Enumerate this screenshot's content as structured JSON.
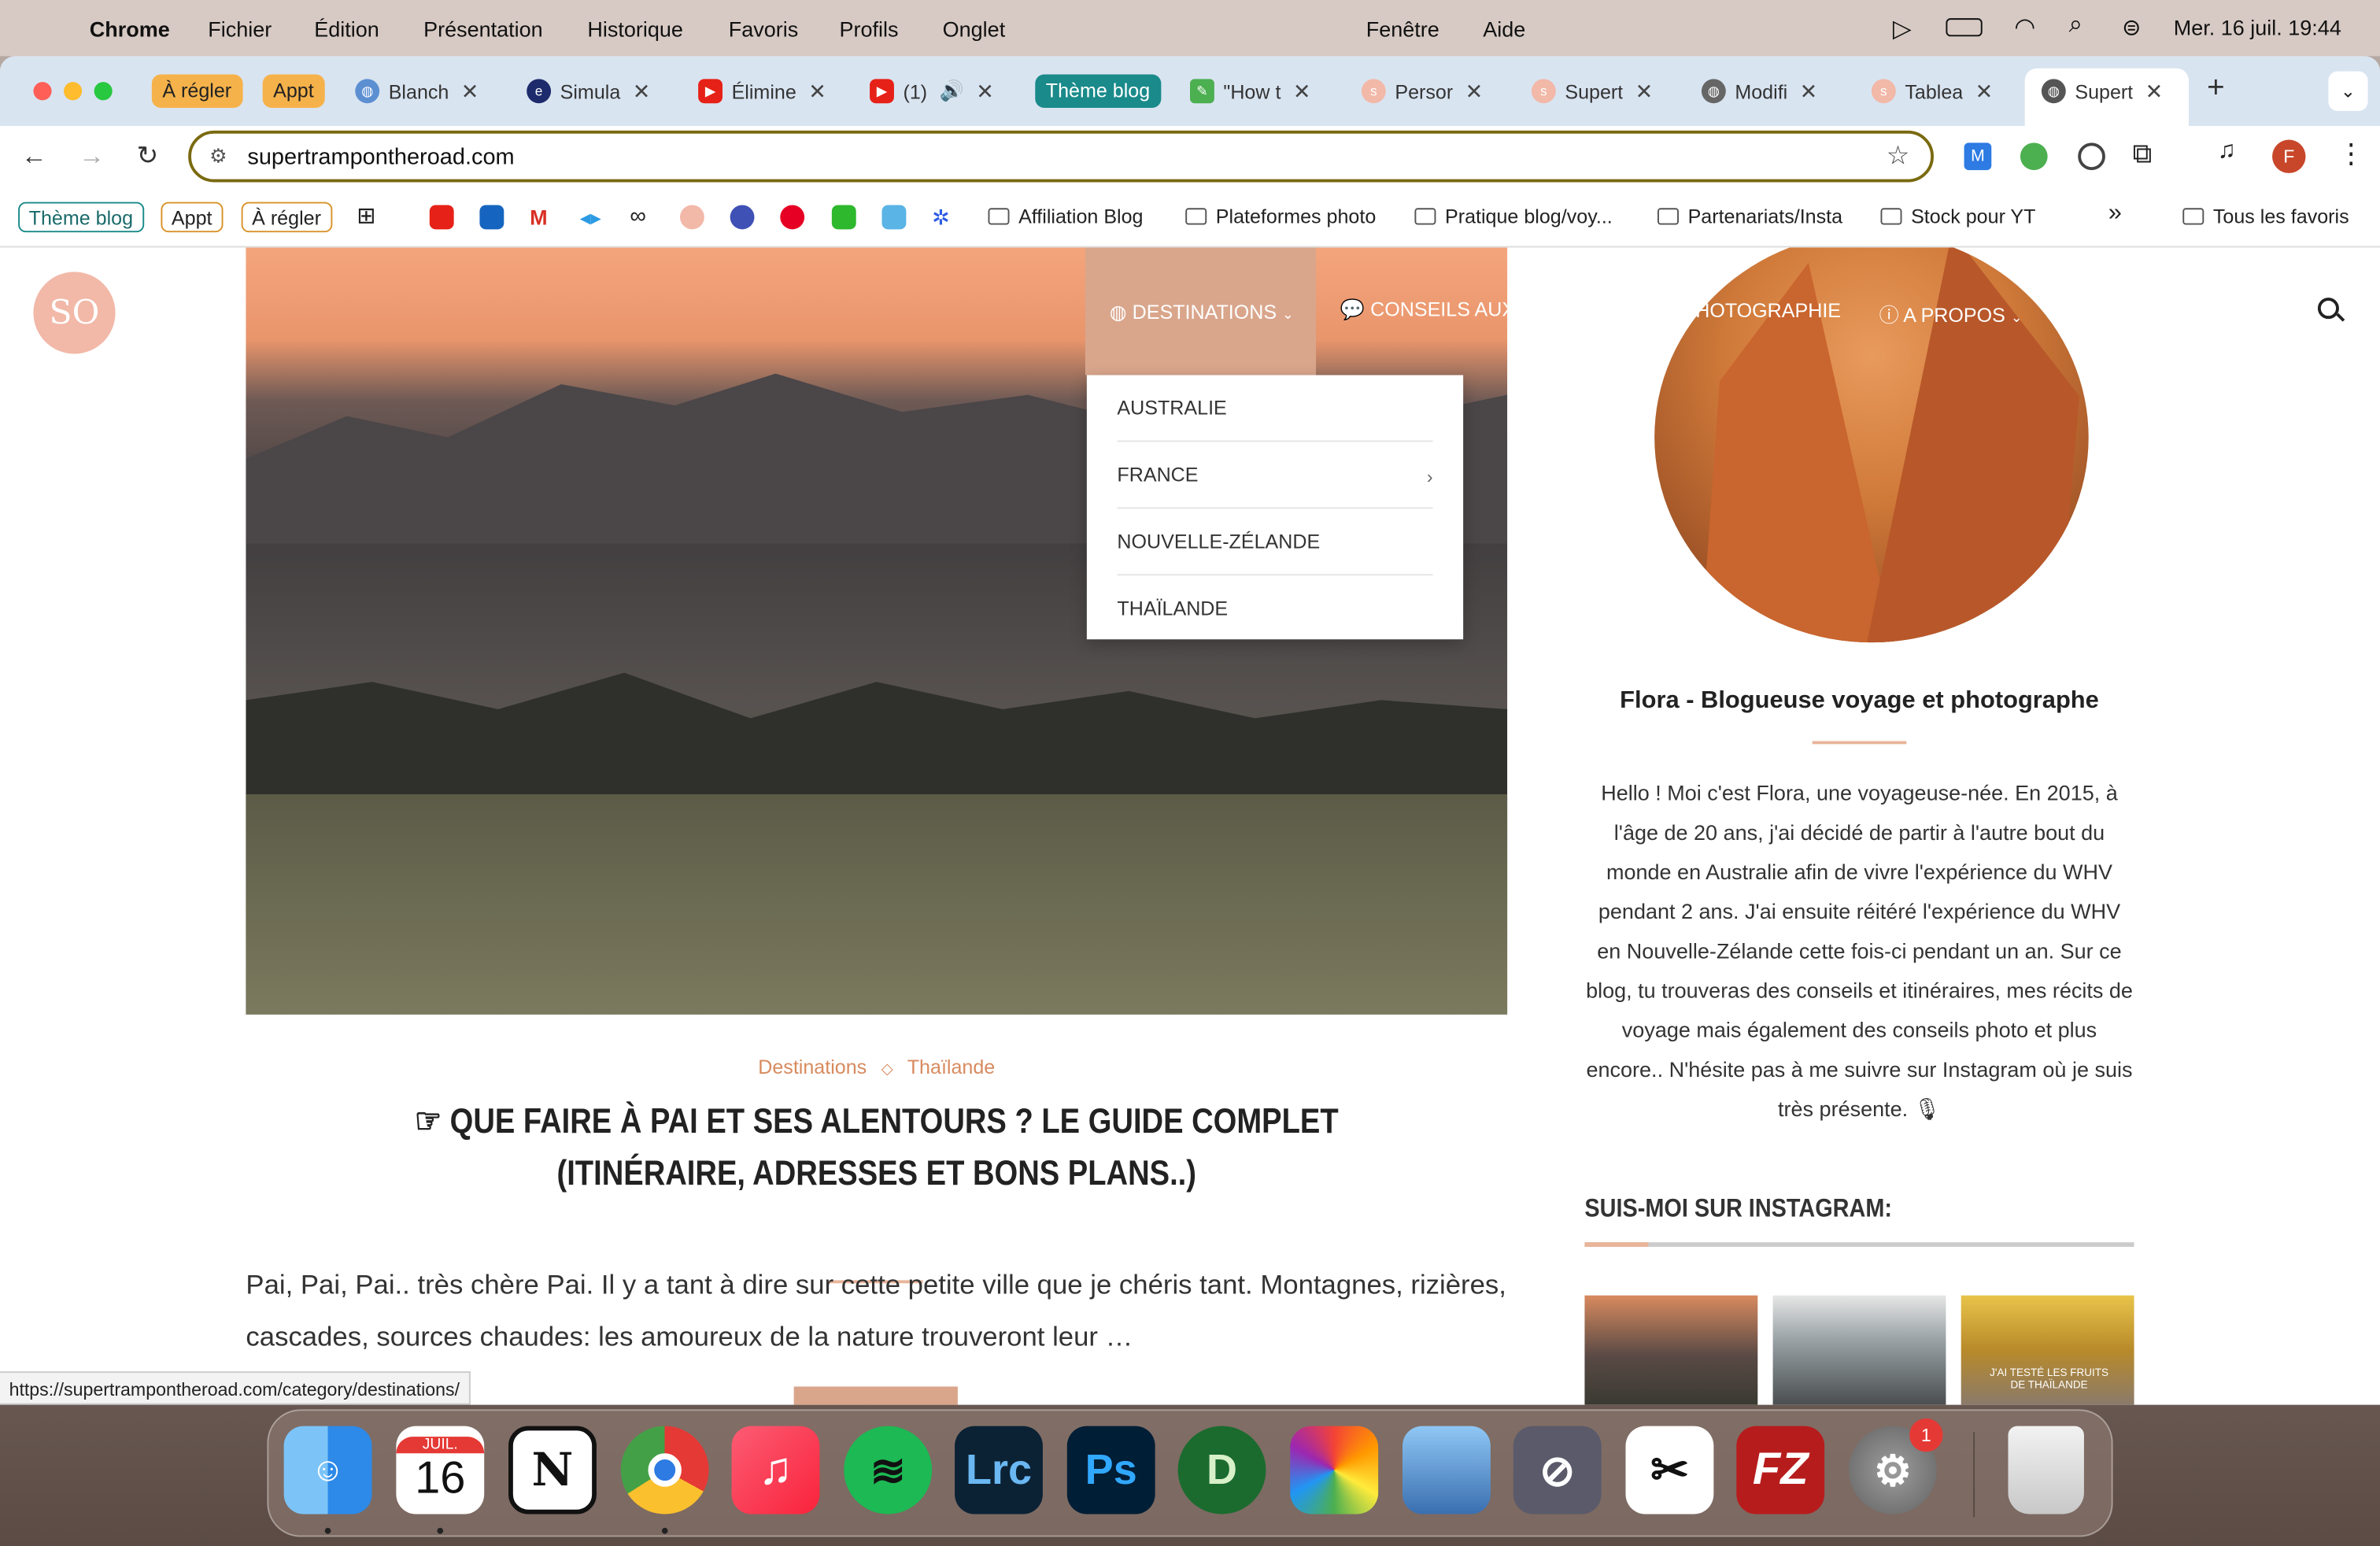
{
  "menubar": {
    "app_name": "Chrome",
    "menus": [
      "Fichier",
      "Édition",
      "Présentation",
      "Historique",
      "Favoris",
      "Profils",
      "Onglet",
      "Fenêtre",
      "Aide"
    ],
    "clock": "Mer. 16 juil.  19:44"
  },
  "tabs": {
    "groups": [
      {
        "label": "À régler",
        "color": "#f6b24a"
      },
      {
        "label": "Appt",
        "color": "#f6b24a"
      },
      {
        "label": "Thème blog",
        "color": "#1a8a8a"
      }
    ],
    "items": [
      "Blanch",
      "Simula",
      "Élimine",
      "(1)",
      "\"How t",
      "Persor",
      "Supert",
      "Modifi",
      "Tablea",
      "Supert"
    ]
  },
  "toolbar": {
    "url": "supertrampontheroad.com",
    "profile_initial": "F"
  },
  "bookmarks": {
    "chips": [
      "Thème blog",
      "Appt",
      "À régler"
    ],
    "folders": [
      "Affiliation Blog",
      "Plateformes photo",
      "Pratique blog/voy...",
      "Partenariats/Insta",
      "Stock pour YT"
    ],
    "all": "Tous les favoris",
    "more": "»"
  },
  "site": {
    "logo_text": "SO",
    "nav": {
      "destinations": "DESTINATIONS",
      "conseils": "CONSEILS AUX V",
      "photographie": "HOTOGRAPHIE",
      "apropos": "A PROPOS"
    },
    "dropdown": [
      "AUSTRALIE",
      "FRANCE",
      "NOUVELLE-ZÉLANDE",
      "THAÏLANDE"
    ],
    "post": {
      "category1": "Destinations",
      "category2": "Thaïlande",
      "title": "☞ QUE FAIRE À PAI ET SES ALENTOURS ? LE GUIDE COMPLET (ITINÉRAIRE, ADRESSES ET BONS PLANS..)",
      "excerpt": "Pai, Pai, Pai.. très chère Pai. Il y a tant à dire sur cette petite ville que je chéris tant. Montagnes, rizières, cascades, sources chaudes: les amoureux de la nature trouveront leur …"
    },
    "sidebar": {
      "author_title": "Flora - Blogueuse voyage et photographe",
      "bio": "Hello ! Moi c'est Flora, une voyageuse-née. En 2015, à l'âge de 20 ans, j'ai décidé de partir à l'autre bout du monde en Australie afin de vivre l'expérience du WHV pendant 2 ans. J'ai ensuite réitéré l'expérience du WHV en Nouvelle-Zélande cette fois-ci pendant un an. Sur ce blog, tu trouveras des conseils et itinéraires, mes récits de voyage mais également des conseils photo et plus encore.. N'hésite pas à me suivre sur Instagram où je suis très présente. 🎙",
      "instagram_title": "SUIS-MOI SUR INSTAGRAM:",
      "thumb3_caption": "J'AI TESTÉ LES FRUITS DE THAÏLANDE"
    }
  },
  "status_url": "https://supertrampontheroad.com/category/destinations/",
  "dock": {
    "calendar_month": "JUIL.",
    "calendar_day": "16",
    "settings_badge": "1",
    "apps": [
      "Finder",
      "Calendrier",
      "Notion",
      "Chrome",
      "Musique",
      "Spotify",
      "Lightroom Classic",
      "Photoshop",
      "DxO",
      "Photos",
      "Aperçu",
      "Utilitaire",
      "CapCut",
      "FileZilla",
      "Réglages Système",
      "Corbeille"
    ]
  }
}
